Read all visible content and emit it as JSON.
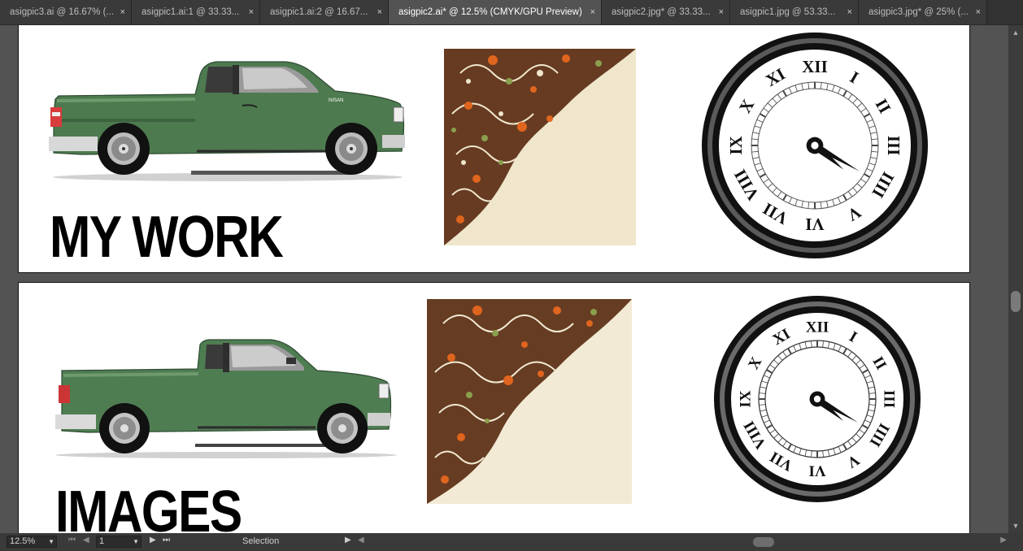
{
  "tabs": [
    {
      "label": "asigpic3.ai @ 16.67% (...",
      "active": false
    },
    {
      "label": "asigpic1.ai:1 @ 33.33...",
      "active": false
    },
    {
      "label": "asigpic1.ai:2 @ 16.67...",
      "active": false
    },
    {
      "label": "asigpic2.ai* @ 12.5% (CMYK/GPU Preview)",
      "active": true
    },
    {
      "label": "asigpic2.jpg* @ 33.33...",
      "active": false
    },
    {
      "label": "asigpic1.jpg @ 53.33...",
      "active": false
    },
    {
      "label": "asigpic3.jpg* @ 25% (...",
      "active": false
    }
  ],
  "close_glyph": "×",
  "artboards": {
    "top": {
      "heading": "MY WORK",
      "truck_badge": "NISAN"
    },
    "bottom": {
      "heading": "IMAGES"
    }
  },
  "clock": {
    "numerals": [
      "XII",
      "I",
      "II",
      "III",
      "IIII",
      "V",
      "VI",
      "VII",
      "VIII",
      "IX",
      "X",
      "XI"
    ],
    "hour": 4,
    "minute": 20
  },
  "colors": {
    "truck_body": "#4d7a4f",
    "truck_dark": "#33573a",
    "swirl_brown": "#5a2c14",
    "swirl_orange": "#e0651e",
    "swirl_green": "#8aa04e",
    "pattern_bg": "#efe6cc"
  },
  "statusbar": {
    "zoom": "12.5%",
    "page": "1",
    "tool": "Selection"
  }
}
